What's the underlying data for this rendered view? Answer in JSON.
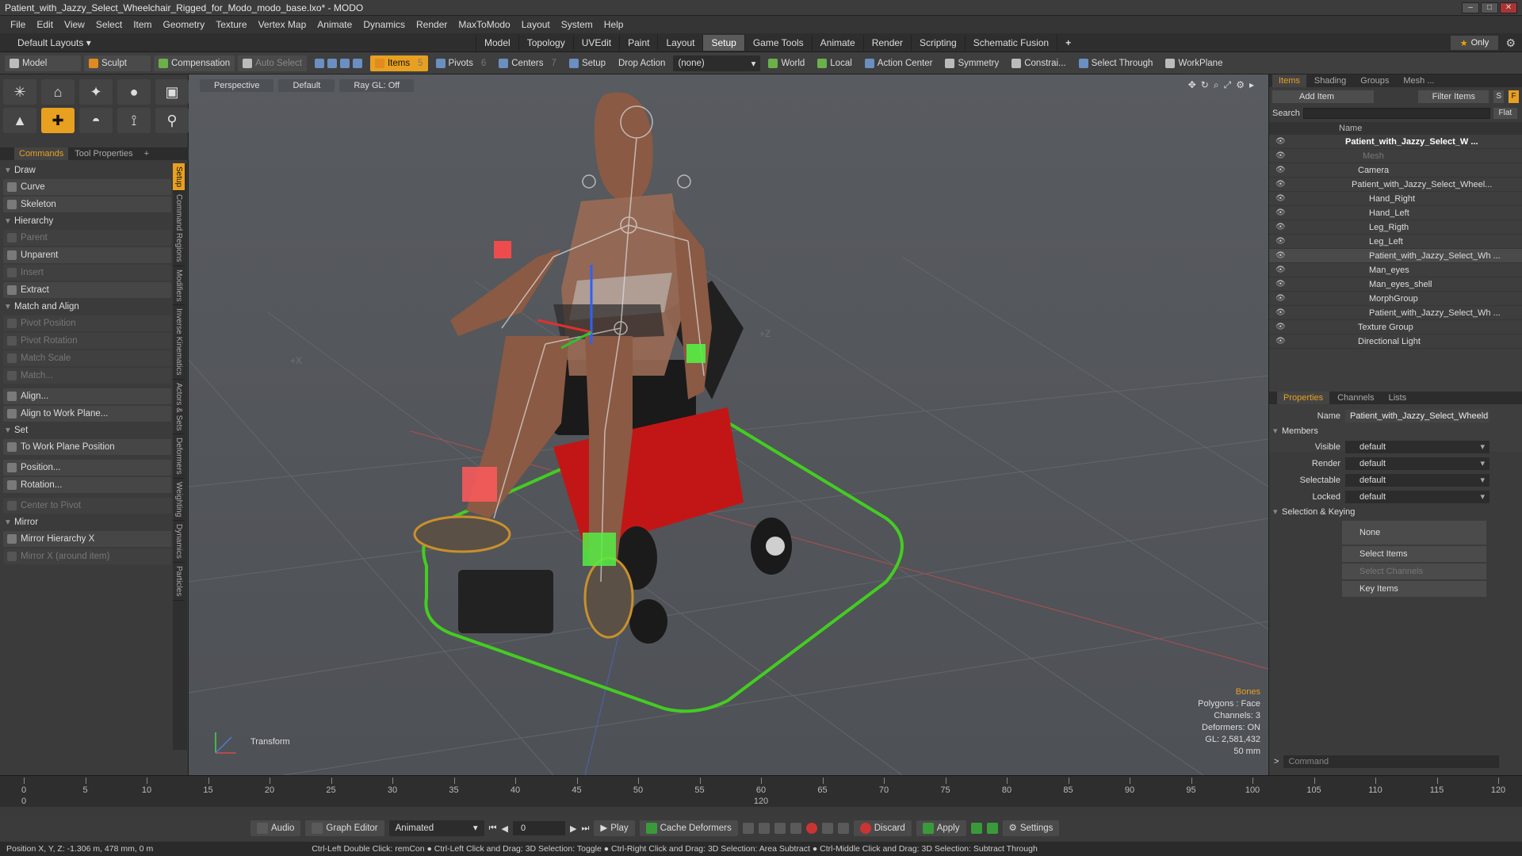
{
  "window": {
    "title": "Patient_with_Jazzy_Select_Wheelchair_Rigged_for_Modo_modo_base.lxo* - MODO"
  },
  "menu": [
    "File",
    "Edit",
    "View",
    "Select",
    "Item",
    "Geometry",
    "Texture",
    "Vertex Map",
    "Animate",
    "Dynamics",
    "Render",
    "MaxToModo",
    "Layout",
    "System",
    "Help"
  ],
  "layout": {
    "selector": "Default Layouts",
    "tabs": [
      "Model",
      "Topology",
      "UVEdit",
      "Paint",
      "Layout",
      "Setup",
      "Game Tools",
      "Animate",
      "Render",
      "Scripting",
      "Schematic Fusion"
    ],
    "active_tab": "Setup",
    "only_label": "Only"
  },
  "toolbar": {
    "model": "Model",
    "sculpt": "Sculpt",
    "compensation": "Compensation",
    "auto_select": "Auto Select",
    "items": "Items",
    "items_count": "5",
    "pivots": "Pivots",
    "pivots_count": "6",
    "centers": "Centers",
    "centers_count": "7",
    "setup": "Setup",
    "drop_action": "Drop Action",
    "drop_value": "(none)",
    "world": "World",
    "local": "Local",
    "action_center": "Action Center",
    "symmetry": "Symmetry",
    "constraints": "Constrai...",
    "select_through": "Select Through",
    "workplane": "WorkPlane"
  },
  "left_panel": {
    "tabs": [
      "Commands",
      "Tool Properties"
    ],
    "sections": {
      "draw": "Draw",
      "curve": "Curve",
      "skeleton": "Skeleton",
      "hierarchy": "Hierarchy",
      "parent": "Parent",
      "unparent": "Unparent",
      "insert": "Insert",
      "extract": "Extract",
      "match_align": "Match and Align",
      "pivot_position": "Pivot Position",
      "pivot_rotation": "Pivot Rotation",
      "match_scale": "Match Scale",
      "match": "Match...",
      "align": "Align...",
      "align_wp": "Align to Work Plane...",
      "set": "Set",
      "to_wp": "To Work Plane Position",
      "position": "Position...",
      "rotation": "Rotation...",
      "center_pivot": "Center to Pivot",
      "mirror": "Mirror",
      "mirror_hier": "Mirror Hierarchy X",
      "mirror_x": "Mirror X (around item)"
    },
    "vtabs": [
      "Setup",
      "Command Regions",
      "Modifiers",
      "Inverse Kinematics",
      "Actors & Sets",
      "Deformers",
      "Weighting",
      "Dynamics",
      "Particles"
    ]
  },
  "viewport": {
    "view": "Perspective",
    "shading": "Default",
    "raygl": "Ray GL: Off",
    "info": {
      "bones": "Bones",
      "polygons": "Polygons : Face",
      "channels": "Channels: 3",
      "deformers": "Deformers: ON",
      "gl": "GL: 2,581,432",
      "scale": "50 mm"
    },
    "transform_label": "Transform",
    "floor_x": "+X",
    "floor_z": "+Z"
  },
  "right_panel": {
    "tabs": [
      "Items",
      "Shading",
      "Groups",
      "Mesh ..."
    ],
    "add_item": "Add Item",
    "filter_items": "Filter Items",
    "s": "S",
    "f": "F",
    "search": "Search",
    "flat": "Flat",
    "name_col": "Name",
    "tree": [
      {
        "name": "Patient_with_Jazzy_Select_W ...",
        "indent": 96
      },
      {
        "name": "Mesh",
        "indent": 118
      },
      {
        "name": "Camera",
        "indent": 112
      },
      {
        "name": "Patient_with_Jazzy_Select_Wheel...",
        "indent": 104
      },
      {
        "name": "Hand_Right",
        "indent": 126
      },
      {
        "name": "Hand_Left",
        "indent": 126
      },
      {
        "name": "Leg_Rigth",
        "indent": 126
      },
      {
        "name": "Leg_Left",
        "indent": 126
      },
      {
        "name": "Patient_with_Jazzy_Select_Wh ...",
        "indent": 126
      },
      {
        "name": "Man_eyes",
        "indent": 126
      },
      {
        "name": "Man_eyes_shell",
        "indent": 126
      },
      {
        "name": "MorphGroup",
        "indent": 126
      },
      {
        "name": "Patient_with_Jazzy_Select_Wh ...",
        "indent": 126
      },
      {
        "name": "Texture Group",
        "indent": 112
      },
      {
        "name": "Directional Light",
        "indent": 112
      }
    ],
    "props_tabs": [
      "Properties",
      "Channels",
      "Lists"
    ],
    "props": {
      "name_label": "Name",
      "name_value": "Patient_with_Jazzy_Select_Wheeld",
      "members": "Members",
      "visible": "Visible",
      "visible_v": "default",
      "render": "Render",
      "render_v": "default",
      "selectable": "Selectable",
      "selectable_v": "default",
      "locked": "Locked",
      "locked_v": "default",
      "sel_keying": "Selection & Keying",
      "none": "None",
      "select_items": "Select Items",
      "select_channels": "Select Channels",
      "key_items": "Key Items"
    },
    "command_placeholder": "Command"
  },
  "timeline": {
    "ticks": [
      "0",
      "5",
      "10",
      "15",
      "20",
      "25",
      "30",
      "35",
      "40",
      "45",
      "50",
      "55",
      "60",
      "65",
      "70",
      "75",
      "80",
      "85",
      "90",
      "95",
      "100",
      "105",
      "110",
      "115",
      "120"
    ],
    "lower_ticks": [
      "0",
      "120"
    ]
  },
  "transport": {
    "audio": "Audio",
    "graph_editor": "Graph Editor",
    "animated": "Animated",
    "frame": "0",
    "play": "Play",
    "cache": "Cache Deformers",
    "discard": "Discard",
    "apply": "Apply",
    "settings": "Settings"
  },
  "status": {
    "position": "Position X, Y, Z:  -1.306 m, 478 mm, 0 m",
    "hint": "Ctrl-Left Double Click: remCon ● Ctrl-Left Click and Drag: 3D Selection: Toggle ● Ctrl-Right Click and Drag: 3D Selection: Area Subtract ● Ctrl-Middle Click and Drag: 3D Selection: Subtract Through"
  }
}
